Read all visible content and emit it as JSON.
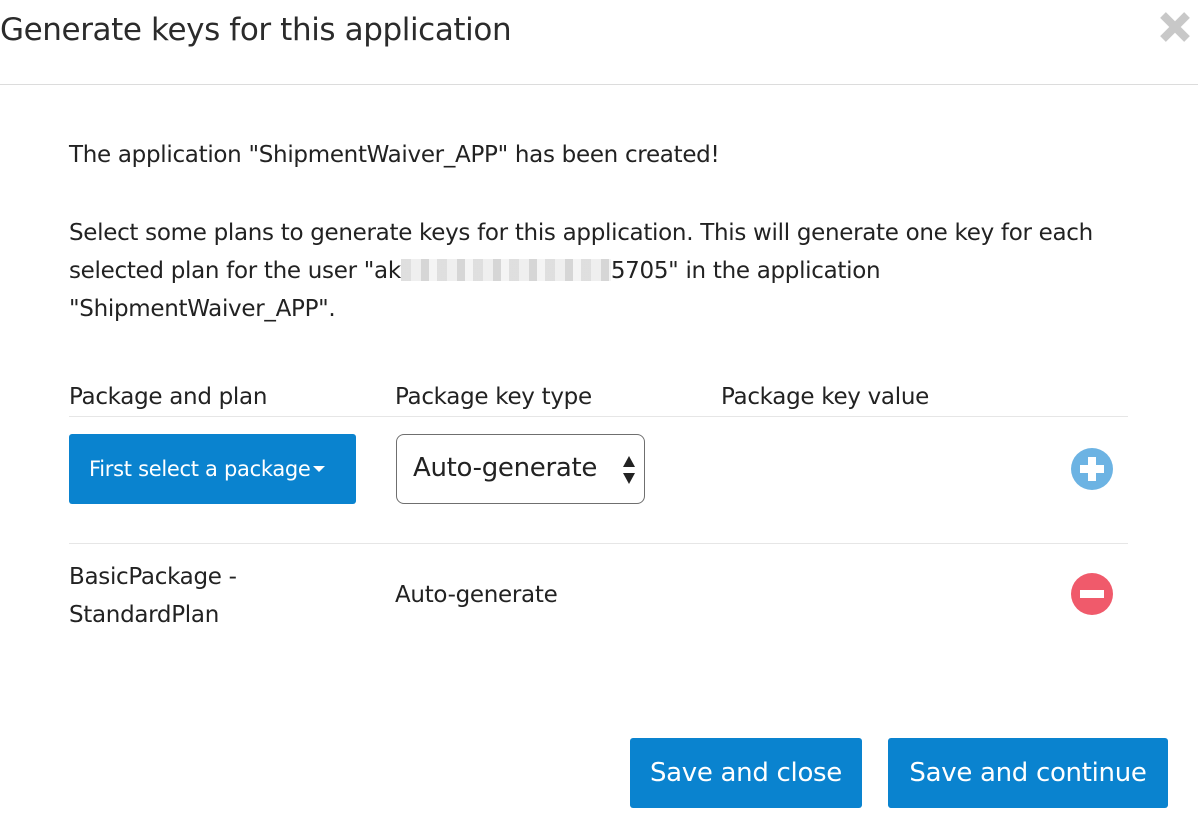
{
  "dialog": {
    "title": "Generate keys for this application",
    "close_icon": "close-icon"
  },
  "messages": {
    "created": "The application \"ShipmentWaiver_APP\" has been created!",
    "instructions_part1": "Select some plans to generate keys for this application. This will generate one key for each selected plan for the user \"ak",
    "instructions_part2": "5705\" in the application \"ShipmentWaiver_APP\"."
  },
  "table": {
    "headers": [
      "Package and plan",
      "Package key type",
      "Package key value"
    ],
    "new_row": {
      "package_button_label": "First select a package",
      "key_type_value": "Auto-generate",
      "add_icon": "plus-circle-icon"
    },
    "rows": [
      {
        "package_plan": "BasicPackage - StandardPlan",
        "key_type": "Auto-generate",
        "key_value": "",
        "remove_icon": "minus-circle-icon"
      }
    ]
  },
  "footer": {
    "save_close_label": "Save and close",
    "save_continue_label": "Save and continue"
  },
  "colors": {
    "primary": "#0a83cf",
    "add_icon": "#6cb3e3",
    "remove_icon": "#f05a6b",
    "close_icon": "#c8c8c8"
  }
}
